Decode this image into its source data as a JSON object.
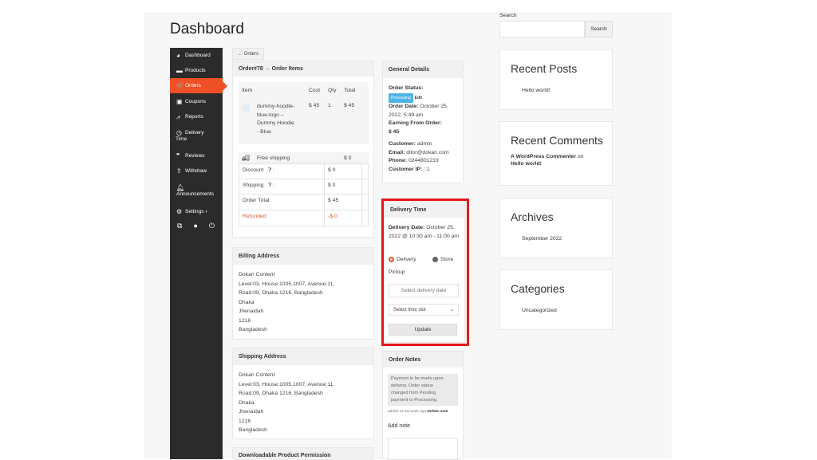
{
  "page_title": "Dashboard",
  "sidebar": {
    "items": [
      {
        "label": "Dashboard",
        "icon": "speedometer-icon"
      },
      {
        "label": "Products",
        "icon": "briefcase-icon"
      },
      {
        "label": "Orders",
        "icon": "cart-icon"
      },
      {
        "label": "Coupons",
        "icon": "gift-icon"
      },
      {
        "label": "Reports",
        "icon": "line-chart-icon"
      },
      {
        "label": "Delivery",
        "label2": "Time",
        "icon": "clock-icon"
      },
      {
        "label": "Reviews",
        "icon": "comments-icon"
      },
      {
        "label": "Withdraw",
        "icon": "upload-icon"
      },
      {
        "label": "Announcements",
        "icon": "bell-icon"
      },
      {
        "label": "Settings",
        "suffix": "›",
        "icon": "gear-icon"
      }
    ],
    "footer_icons": [
      "external-link-icon",
      "user-icon",
      "power-icon"
    ]
  },
  "orders_button": "← Orders",
  "order_items": {
    "heading": "Order#78 → Order Items",
    "headers": {
      "item": "Item",
      "cost": "Cost",
      "qty": "Qty",
      "total": "Total"
    },
    "item": {
      "name": "dummy-hoodie-blue-logo – Dummy Hoodie - Blue",
      "name_lines": [
        "dummy-hoodie-",
        "blue-logo –",
        "Dummy Hoodie",
        "- Blue"
      ],
      "cost": "$ 45",
      "qty": "1",
      "total": "$ 45"
    },
    "shipping": {
      "label": "Free shipping",
      "total": "$ 0"
    },
    "totals": [
      {
        "label": "Discount",
        "value": "$ 0"
      },
      {
        "label": "Shipping",
        "value": "$ 0"
      },
      {
        "label": "Order Total:",
        "value": "$ 45"
      },
      {
        "label": "Refunded:",
        "value": "-$ 0"
      }
    ]
  },
  "general": {
    "heading": "General Details",
    "status_label": "Order Status:",
    "status": "Processing",
    "edit": "Edit",
    "date_label": "Order Date:",
    "date": "October 25, 2022, 5:49 am",
    "earning_label": "Earning From Order:",
    "earning": "$ 45",
    "customer_label": "Customer:",
    "customer": "admin",
    "email_label": "Email:",
    "email": "ditor@dokan.com",
    "phone_label": "Phone:",
    "phone": "0244801219",
    "ip_label": "Customer IP:",
    "ip": "::1"
  },
  "delivery": {
    "heading": "Delivery Time",
    "date_label": "Delivery Date:",
    "date": "October 25, 2022 @ 10:30 am - 11:00 am",
    "option_delivery": "Delivery",
    "option_store": "Store",
    "option_pickup": "Pickup",
    "date_placeholder": "Select delivery date",
    "slot": "Select time slot",
    "update": "Update"
  },
  "billing": {
    "heading": "Billing Address",
    "lines": [
      "Dokan Content",
      "Level:03, House:1005,1007, Avenue:11,",
      "Road:09, Dhaka 1216, Bangladesh",
      "Dhaka",
      "Jhenaidah",
      "1216",
      "Bangladesh"
    ]
  },
  "shipping": {
    "heading": "Shipping Address",
    "lines": [
      "Dokan Content",
      "Level:03, House:1005,1007, Avenue:11,",
      "Road:09, Dhaka 1216, Bangladesh",
      "Dhaka",
      "Jhenaidah",
      "1216",
      "Bangladesh"
    ]
  },
  "downloadable": {
    "heading": "Downloadable Product Permission"
  },
  "notes": {
    "heading": "Order Notes",
    "note": "Payment to be made upon delivery. Order status changed from Pending payment to Processing.",
    "note_lines": [
      "Payment to be made upon",
      "delivery. Order status",
      "changed from Pending",
      "payment to Processing."
    ],
    "meta": "added 11 seconds ago",
    "delete": "Delete note",
    "add": "Add note"
  },
  "widgets": {
    "search_label": "Search",
    "search_button": "Search",
    "recent_posts": {
      "title": "Recent Posts",
      "items": [
        "Hello world!"
      ]
    },
    "recent_comments": {
      "title": "Recent Comments",
      "author": "A WordPress Commenter",
      "on": "on",
      "post": "Hello world!"
    },
    "archives": {
      "title": "Archives",
      "items": [
        "September 2022"
      ]
    },
    "categories": {
      "title": "Categories",
      "items": [
        "Uncategorized"
      ]
    }
  },
  "colors": {
    "accent": "#f05025",
    "sidebar": "#2b2b2b",
    "highlight": "#e3191b",
    "status": "#4eb3e5"
  }
}
